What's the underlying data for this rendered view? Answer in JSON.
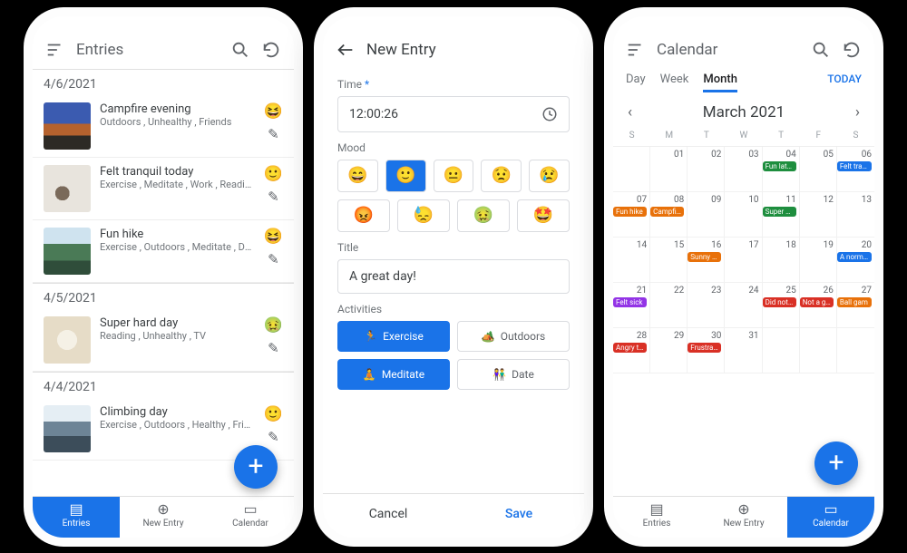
{
  "phone1": {
    "header_title": "Entries",
    "sections": [
      {
        "date": "4/6/2021",
        "entries": [
          {
            "title": "Campfire evening",
            "tags": "Outdoors , Unhealthy , Friends",
            "mood": "😆",
            "thumb": "g1"
          },
          {
            "title": "Felt tranquil today",
            "tags": "Exercise , Meditate , Work , Reading , Healt…",
            "mood": "🙂",
            "thumb": "g2"
          },
          {
            "title": "Fun hike",
            "tags": "Exercise , Outdoors , Meditate , Date , Heal…",
            "mood": "😆",
            "thumb": "g3"
          }
        ]
      },
      {
        "date": "4/5/2021",
        "entries": [
          {
            "title": "Super hard day",
            "tags": "Reading , Unhealthy , TV",
            "mood": "🤢",
            "thumb": "g4"
          }
        ]
      },
      {
        "date": "4/4/2021",
        "entries": [
          {
            "title": "Climbing day",
            "tags": "Exercise , Outdoors , Healthy , Fri…",
            "mood": "🙂",
            "thumb": "g5"
          }
        ]
      }
    ],
    "tabs": {
      "entries": "Entries",
      "new": "New Entry",
      "cal": "Calendar"
    }
  },
  "phone2": {
    "header_title": "New Entry",
    "time_label": "Time",
    "time_value": "12:00:26",
    "mood_label": "Mood",
    "moods_row1": [
      "😄",
      "🙂",
      "😐",
      "😟",
      "😢"
    ],
    "moods_row2": [
      "😡",
      "😓",
      "🤢",
      "🤩"
    ],
    "mood_selected_index": 1,
    "title_label": "Title",
    "title_value": "A great day!",
    "activities_label": "Activities",
    "activities": [
      {
        "icon": "🏃",
        "label": "Exercise",
        "sel": true
      },
      {
        "icon": "🏕️",
        "label": "Outdoors",
        "sel": false
      },
      {
        "icon": "🧘",
        "label": "Meditate",
        "sel": true
      },
      {
        "icon": "👫",
        "label": "Date",
        "sel": false
      }
    ],
    "cancel": "Cancel",
    "save": "Save"
  },
  "phone3": {
    "header_title": "Calendar",
    "view_tabs": {
      "day": "Day",
      "week": "Week",
      "month": "Month",
      "today": "TODAY"
    },
    "month_label": "March 2021",
    "dow": [
      "S",
      "M",
      "T",
      "W",
      "T",
      "F",
      "S"
    ],
    "weeks": [
      [
        {
          "n": ""
        },
        {
          "n": "01"
        },
        {
          "n": "02"
        },
        {
          "n": "03"
        },
        {
          "n": "04",
          "ev": [
            {
              "t": "Fun late n",
              "c": "#1e8e3e"
            }
          ]
        },
        {
          "n": "05"
        },
        {
          "n": "06",
          "ev": [
            {
              "t": "Felt tranq",
              "c": "#1a73e8"
            }
          ]
        }
      ],
      [
        {
          "n": "07",
          "ev": [
            {
              "t": "Fun hike",
              "c": "#e8710a"
            }
          ]
        },
        {
          "n": "08",
          "ev": [
            {
              "t": "Campfire",
              "c": "#e8710a"
            }
          ]
        },
        {
          "n": "09"
        },
        {
          "n": "10"
        },
        {
          "n": "11",
          "ev": [
            {
              "t": "Super ha",
              "c": "#1e8e3e"
            }
          ]
        },
        {
          "n": "12"
        },
        {
          "n": "13"
        }
      ],
      [
        {
          "n": "14"
        },
        {
          "n": "15"
        },
        {
          "n": "16",
          "ev": [
            {
              "t": "Sunny da",
              "c": "#e8710a"
            }
          ]
        },
        {
          "n": "17"
        },
        {
          "n": "18"
        },
        {
          "n": "19"
        },
        {
          "n": "20",
          "ev": [
            {
              "t": "A normal",
              "c": "#1a73e8"
            }
          ]
        }
      ],
      [
        {
          "n": "21",
          "ev": [
            {
              "t": "Felt sick",
              "c": "#9334e6"
            }
          ]
        },
        {
          "n": "22"
        },
        {
          "n": "23"
        },
        {
          "n": "24"
        },
        {
          "n": "25",
          "ev": [
            {
              "t": "Did not s",
              "c": "#d93025"
            }
          ]
        },
        {
          "n": "26",
          "ev": [
            {
              "t": "Not a gre",
              "c": "#d93025"
            }
          ]
        },
        {
          "n": "27",
          "ev": [
            {
              "t": "Ball gam",
              "c": "#e8710a"
            }
          ]
        }
      ],
      [
        {
          "n": "28",
          "ev": [
            {
              "t": "Angry tod",
              "c": "#d93025"
            }
          ]
        },
        {
          "n": "29"
        },
        {
          "n": "30",
          "ev": [
            {
              "t": "Frustratin",
              "c": "#d93025"
            }
          ]
        },
        {
          "n": "31"
        },
        {
          "n": ""
        },
        {
          "n": ""
        },
        {
          "n": ""
        }
      ]
    ],
    "tabs": {
      "entries": "Entries",
      "new": "New Entry",
      "cal": "Calendar"
    }
  }
}
